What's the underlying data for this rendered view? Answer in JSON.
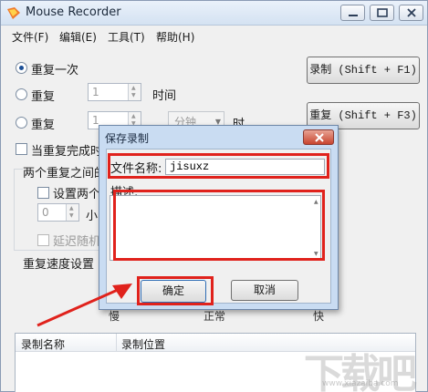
{
  "window": {
    "title": "Mouse Recorder"
  },
  "menu": [
    "文件(F)",
    "编辑(E)",
    "工具(T)",
    "帮助(H)"
  ],
  "options": {
    "repeat_once": "重复一次",
    "repeat_times": "重复",
    "repeat_times_value": "1",
    "times_unit": "时间",
    "repeat_duration": "重复",
    "repeat_duration_value": "1",
    "duration_unit_select": "分钟",
    "duration_suffix": "时",
    "when_done": "当重复完成时",
    "interval_label": "两个重复之间的",
    "set_two": "设置两个",
    "interval_value": "0",
    "interval_unit": "小",
    "delay_random": "延迟随机",
    "speed_label": "重复速度设置",
    "speed_slow": "慢",
    "speed_normal": "正常",
    "speed_fast": "快"
  },
  "buttons": {
    "record": "录制 (Shift + F1)",
    "replay": "重复 (Shift + F3)"
  },
  "table": {
    "columns": [
      "录制名称",
      "录制位置"
    ],
    "rows": []
  },
  "dialog": {
    "title": "保存录制",
    "name_label": "文件名称:",
    "name_value": "jisuxz",
    "desc_label": "描述:",
    "ok": "确定",
    "cancel": "取消"
  },
  "colors": {
    "highlight": "#e0221c",
    "dialog_frame": "#c9dcf2"
  },
  "icons": [
    "app-icon",
    "minimize-icon",
    "maximize-icon",
    "close-icon",
    "dialog-close-icon",
    "arrow-annotation"
  ]
}
